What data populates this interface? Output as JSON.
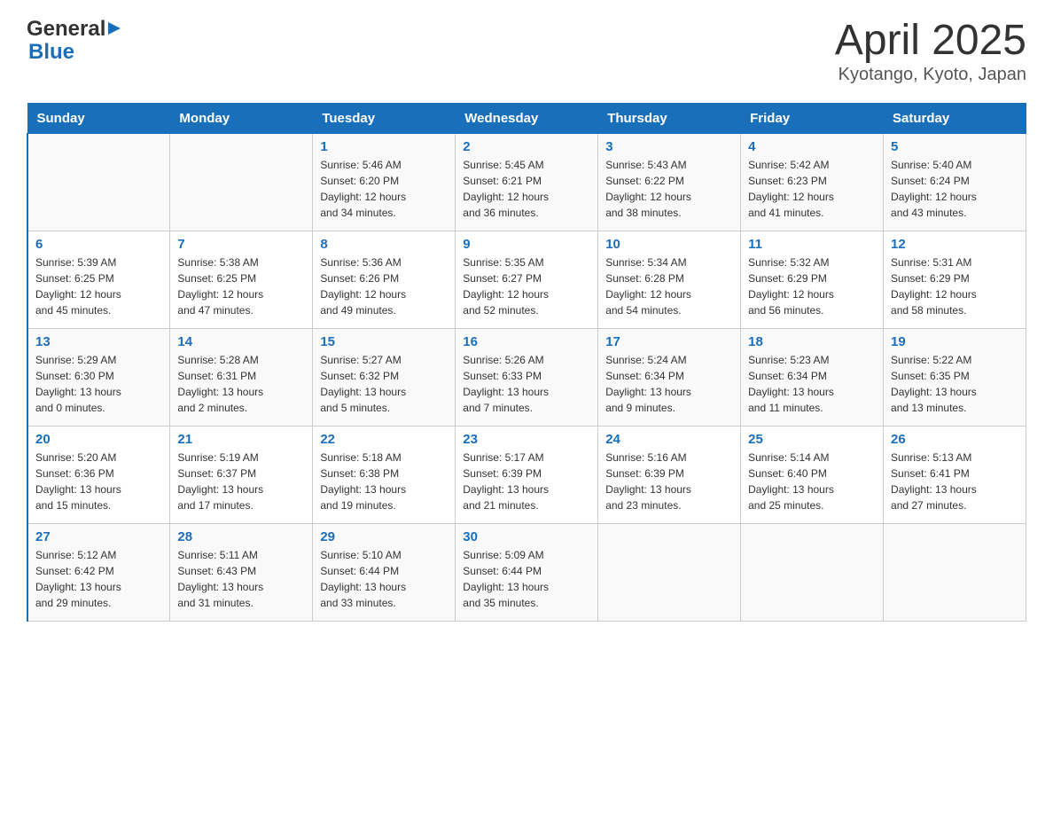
{
  "header": {
    "logo_text_general": "General",
    "logo_text_blue": "Blue",
    "title": "April 2025",
    "subtitle": "Kyotango, Kyoto, Japan"
  },
  "columns": [
    "Sunday",
    "Monday",
    "Tuesday",
    "Wednesday",
    "Thursday",
    "Friday",
    "Saturday"
  ],
  "weeks": [
    [
      {
        "day": "",
        "info": ""
      },
      {
        "day": "",
        "info": ""
      },
      {
        "day": "1",
        "info": "Sunrise: 5:46 AM\nSunset: 6:20 PM\nDaylight: 12 hours\nand 34 minutes."
      },
      {
        "day": "2",
        "info": "Sunrise: 5:45 AM\nSunset: 6:21 PM\nDaylight: 12 hours\nand 36 minutes."
      },
      {
        "day": "3",
        "info": "Sunrise: 5:43 AM\nSunset: 6:22 PM\nDaylight: 12 hours\nand 38 minutes."
      },
      {
        "day": "4",
        "info": "Sunrise: 5:42 AM\nSunset: 6:23 PM\nDaylight: 12 hours\nand 41 minutes."
      },
      {
        "day": "5",
        "info": "Sunrise: 5:40 AM\nSunset: 6:24 PM\nDaylight: 12 hours\nand 43 minutes."
      }
    ],
    [
      {
        "day": "6",
        "info": "Sunrise: 5:39 AM\nSunset: 6:25 PM\nDaylight: 12 hours\nand 45 minutes."
      },
      {
        "day": "7",
        "info": "Sunrise: 5:38 AM\nSunset: 6:25 PM\nDaylight: 12 hours\nand 47 minutes."
      },
      {
        "day": "8",
        "info": "Sunrise: 5:36 AM\nSunset: 6:26 PM\nDaylight: 12 hours\nand 49 minutes."
      },
      {
        "day": "9",
        "info": "Sunrise: 5:35 AM\nSunset: 6:27 PM\nDaylight: 12 hours\nand 52 minutes."
      },
      {
        "day": "10",
        "info": "Sunrise: 5:34 AM\nSunset: 6:28 PM\nDaylight: 12 hours\nand 54 minutes."
      },
      {
        "day": "11",
        "info": "Sunrise: 5:32 AM\nSunset: 6:29 PM\nDaylight: 12 hours\nand 56 minutes."
      },
      {
        "day": "12",
        "info": "Sunrise: 5:31 AM\nSunset: 6:29 PM\nDaylight: 12 hours\nand 58 minutes."
      }
    ],
    [
      {
        "day": "13",
        "info": "Sunrise: 5:29 AM\nSunset: 6:30 PM\nDaylight: 13 hours\nand 0 minutes."
      },
      {
        "day": "14",
        "info": "Sunrise: 5:28 AM\nSunset: 6:31 PM\nDaylight: 13 hours\nand 2 minutes."
      },
      {
        "day": "15",
        "info": "Sunrise: 5:27 AM\nSunset: 6:32 PM\nDaylight: 13 hours\nand 5 minutes."
      },
      {
        "day": "16",
        "info": "Sunrise: 5:26 AM\nSunset: 6:33 PM\nDaylight: 13 hours\nand 7 minutes."
      },
      {
        "day": "17",
        "info": "Sunrise: 5:24 AM\nSunset: 6:34 PM\nDaylight: 13 hours\nand 9 minutes."
      },
      {
        "day": "18",
        "info": "Sunrise: 5:23 AM\nSunset: 6:34 PM\nDaylight: 13 hours\nand 11 minutes."
      },
      {
        "day": "19",
        "info": "Sunrise: 5:22 AM\nSunset: 6:35 PM\nDaylight: 13 hours\nand 13 minutes."
      }
    ],
    [
      {
        "day": "20",
        "info": "Sunrise: 5:20 AM\nSunset: 6:36 PM\nDaylight: 13 hours\nand 15 minutes."
      },
      {
        "day": "21",
        "info": "Sunrise: 5:19 AM\nSunset: 6:37 PM\nDaylight: 13 hours\nand 17 minutes."
      },
      {
        "day": "22",
        "info": "Sunrise: 5:18 AM\nSunset: 6:38 PM\nDaylight: 13 hours\nand 19 minutes."
      },
      {
        "day": "23",
        "info": "Sunrise: 5:17 AM\nSunset: 6:39 PM\nDaylight: 13 hours\nand 21 minutes."
      },
      {
        "day": "24",
        "info": "Sunrise: 5:16 AM\nSunset: 6:39 PM\nDaylight: 13 hours\nand 23 minutes."
      },
      {
        "day": "25",
        "info": "Sunrise: 5:14 AM\nSunset: 6:40 PM\nDaylight: 13 hours\nand 25 minutes."
      },
      {
        "day": "26",
        "info": "Sunrise: 5:13 AM\nSunset: 6:41 PM\nDaylight: 13 hours\nand 27 minutes."
      }
    ],
    [
      {
        "day": "27",
        "info": "Sunrise: 5:12 AM\nSunset: 6:42 PM\nDaylight: 13 hours\nand 29 minutes."
      },
      {
        "day": "28",
        "info": "Sunrise: 5:11 AM\nSunset: 6:43 PM\nDaylight: 13 hours\nand 31 minutes."
      },
      {
        "day": "29",
        "info": "Sunrise: 5:10 AM\nSunset: 6:44 PM\nDaylight: 13 hours\nand 33 minutes."
      },
      {
        "day": "30",
        "info": "Sunrise: 5:09 AM\nSunset: 6:44 PM\nDaylight: 13 hours\nand 35 minutes."
      },
      {
        "day": "",
        "info": ""
      },
      {
        "day": "",
        "info": ""
      },
      {
        "day": "",
        "info": ""
      }
    ]
  ]
}
